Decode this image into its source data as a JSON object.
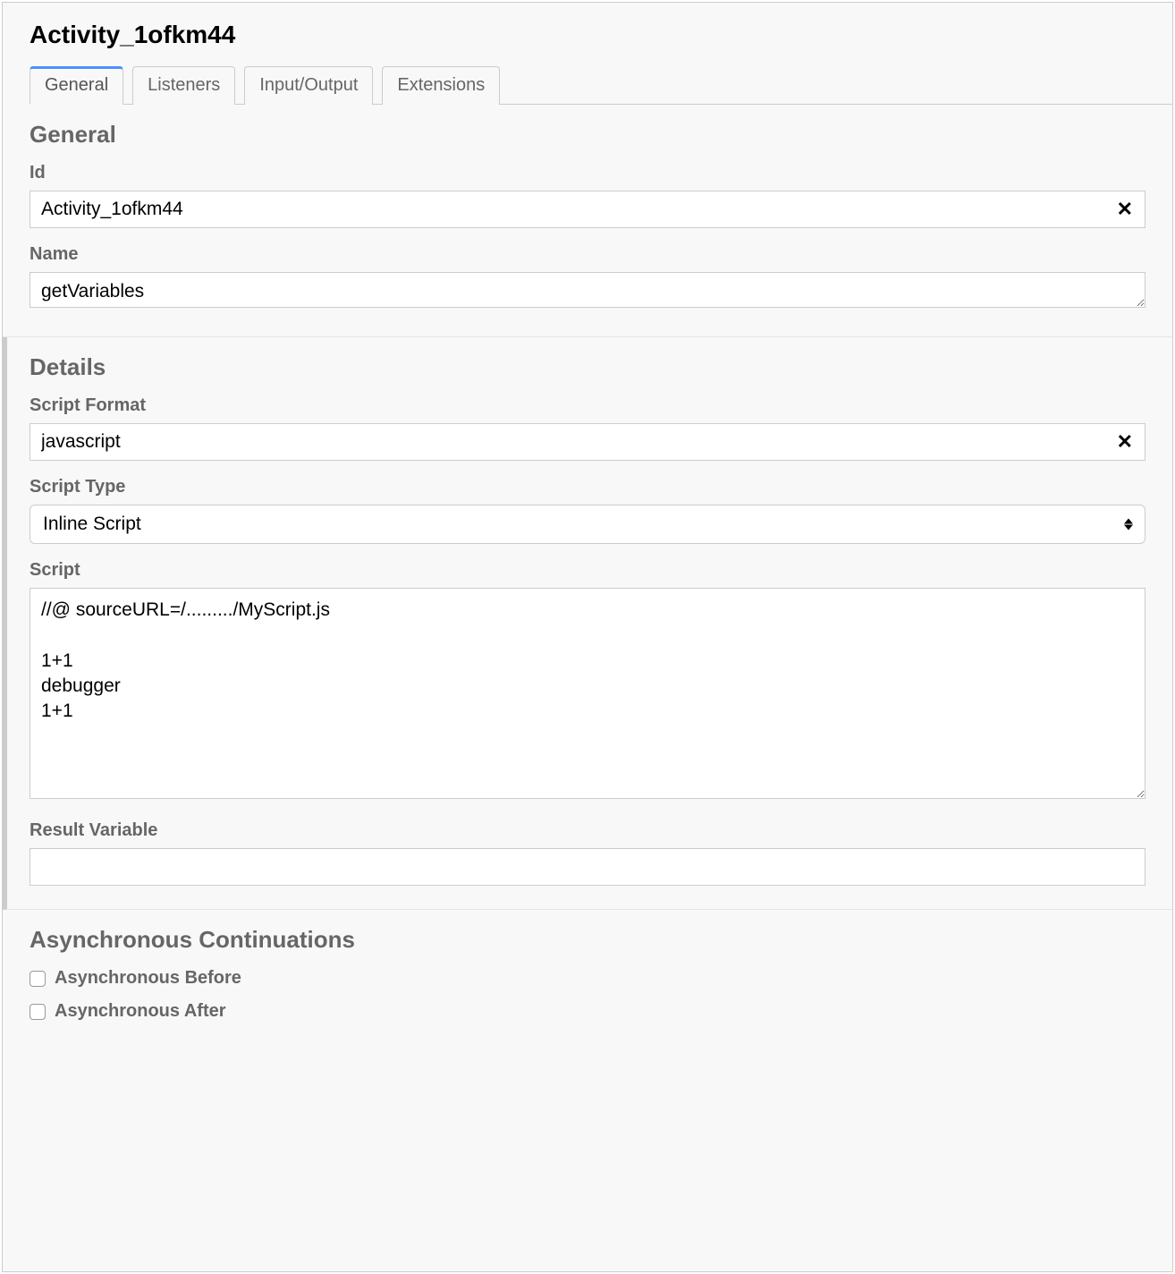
{
  "title": "Activity_1ofkm44",
  "tabs": [
    {
      "label": "General",
      "active": true
    },
    {
      "label": "Listeners",
      "active": false
    },
    {
      "label": "Input/Output",
      "active": false
    },
    {
      "label": "Extensions",
      "active": false
    }
  ],
  "sections": {
    "general": {
      "heading": "General",
      "id_label": "Id",
      "id_value": "Activity_1ofkm44",
      "name_label": "Name",
      "name_value": "getVariables"
    },
    "details": {
      "heading": "Details",
      "script_format_label": "Script Format",
      "script_format_value": "javascript",
      "script_type_label": "Script Type",
      "script_type_value": "Inline Script",
      "script_label": "Script",
      "script_value": "//@ sourceURL=/........./MyScript.js\n\n1+1\ndebugger\n1+1",
      "result_var_label": "Result Variable",
      "result_var_value": ""
    },
    "async": {
      "heading": "Asynchronous Continuations",
      "before_label": "Asynchronous Before",
      "before_checked": false,
      "after_label": "Asynchronous After",
      "after_checked": false
    }
  },
  "icons": {
    "clear": "✕"
  }
}
